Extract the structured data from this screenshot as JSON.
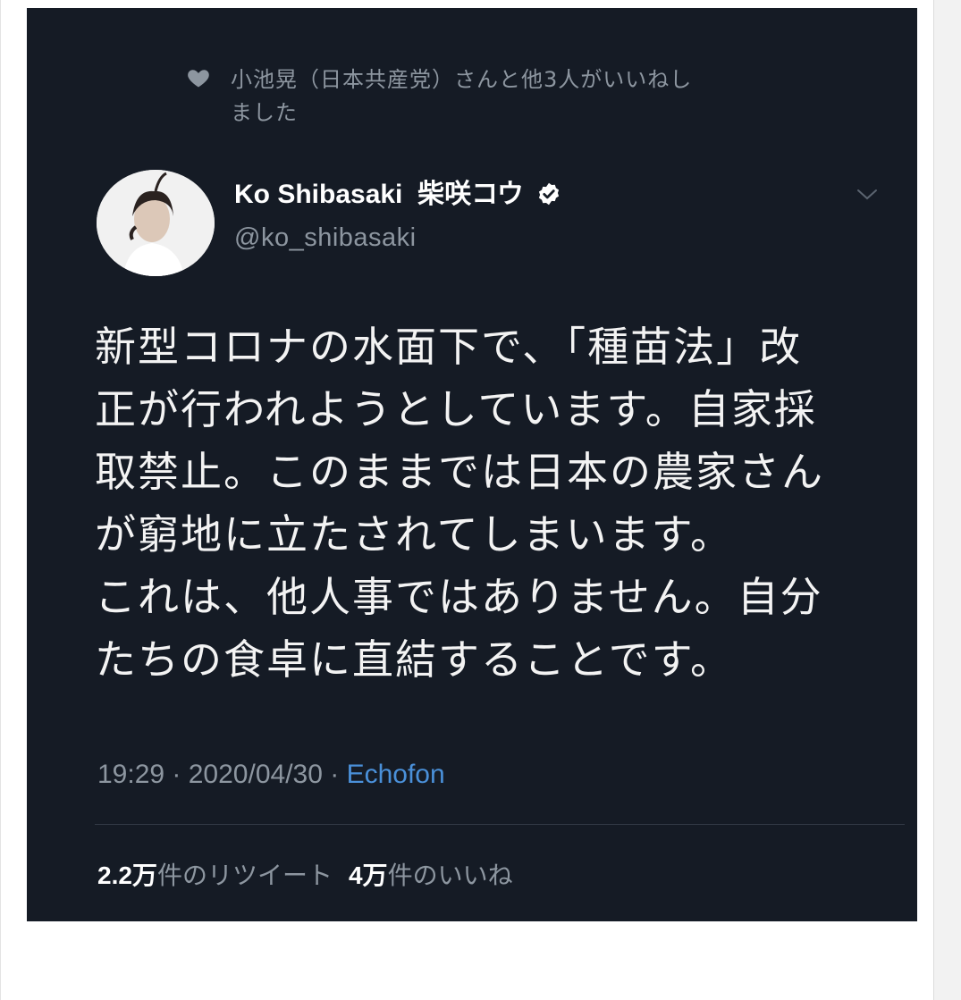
{
  "liked_by": {
    "icon": "heart-icon",
    "text_line1": "小池晃（日本共産党）さんと他3人がいいねし",
    "text_line2": "ました"
  },
  "author": {
    "avatar": "avatar",
    "name_en": "Ko Shibasaki",
    "name_ja": "柴咲コウ",
    "verified_icon": "verified-badge-icon",
    "handle": "@ko_shibasaki",
    "menu_icon": "chevron-down-icon"
  },
  "tweet": {
    "lines": [
      "新型コロナの水面下で、「種苗法」改",
      "正が行われようとしています。自家採",
      "取禁止。このままでは日本の農家さん",
      "が窮地に立たされてしまいます。",
      "これは、他人事ではありません。自分",
      "たちの食卓に直結することです。"
    ]
  },
  "meta": {
    "time": "19:29",
    "sep1": " · ",
    "date": "2020/04/30",
    "sep2": " · ",
    "source": "Echofon"
  },
  "stats": {
    "retweets_num": "2.2",
    "retweets_unit": "万",
    "retweets_label": "件のリツイート",
    "likes_num": "4",
    "likes_unit": "万",
    "likes_label": "件のいいね"
  },
  "colors": {
    "card_bg": "#151b25",
    "muted_text": "#8d96a0",
    "link": "#4a90d9"
  }
}
